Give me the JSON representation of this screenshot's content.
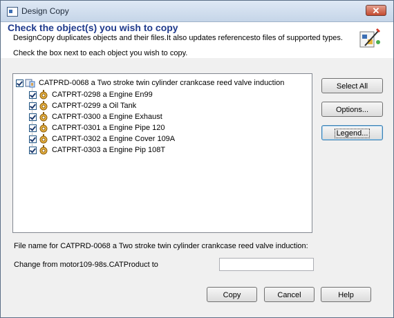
{
  "window": {
    "title": "Design Copy",
    "close_label": "✕"
  },
  "header": {
    "title": "Check the object(s) you wish to copy",
    "description": "DesignCopy duplicates objects and their files.It also updates referencesto files of supported types.",
    "instruction": "Check the box next to each object you wish to copy."
  },
  "tree": {
    "root": {
      "label": "CATPRD-0068 a Two stroke twin cylinder crankcase reed valve induction",
      "checked": true
    },
    "children": [
      {
        "label": "CATPRT-0298 a Engine En99",
        "checked": true
      },
      {
        "label": "CATPRT-0299 a Oil Tank",
        "checked": true
      },
      {
        "label": "CATPRT-0300 a Engine Exhaust",
        "checked": true
      },
      {
        "label": "CATPRT-0301 a Engine Pipe 120",
        "checked": true
      },
      {
        "label": "CATPRT-0302 a Engine Cover 109A",
        "checked": true
      },
      {
        "label": "CATPRT-0303 a Engine Pip 108T",
        "checked": true
      }
    ]
  },
  "side_buttons": {
    "select_all": "Select All",
    "options": "Options...",
    "legend": "Legend..."
  },
  "filename": {
    "label": "File name for CATPRD-0068 a Two stroke twin cylinder crankcase reed valve induction:",
    "change_label": "Change from motor109-98s.CATProduct to",
    "value": ""
  },
  "bottom_buttons": {
    "copy": "Copy",
    "cancel": "Cancel",
    "help": "Help"
  }
}
